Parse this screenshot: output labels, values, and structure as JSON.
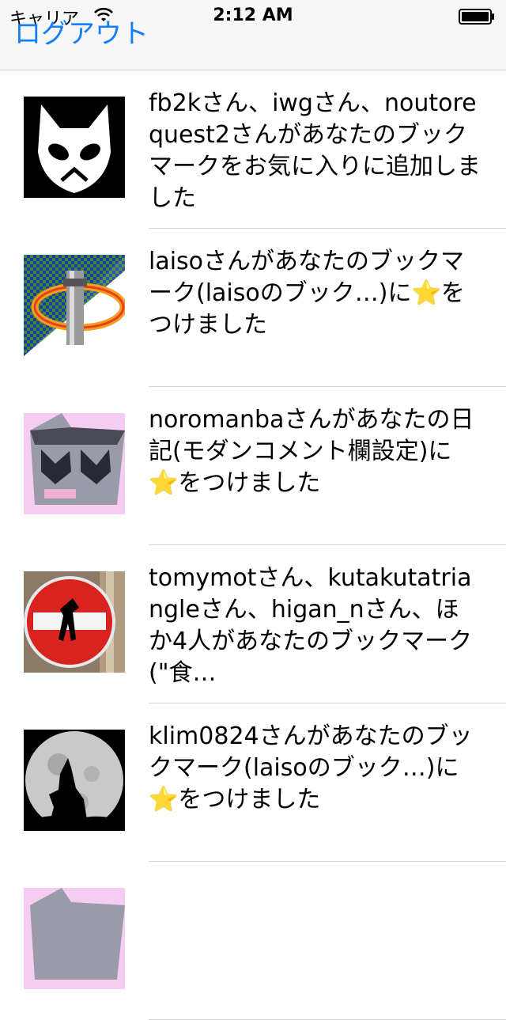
{
  "status_bar": {
    "carrier": "キャリア",
    "time": "2:12 AM"
  },
  "nav": {
    "logout_label": "ログアウト"
  },
  "notifications": [
    {
      "avatar_icon": "alien-mask-avatar-icon",
      "text_before": "fb2kさん、iwgさん、noutorequest2さんがあなたのブックマークをお気に入りに追加しました",
      "star": "",
      "text_after": ""
    },
    {
      "avatar_icon": "pixel-ring-avatar-icon",
      "text_before": "laisoさんがあなたのブックマーク(laisoのブック…)に",
      "star": "⭐",
      "text_after": "をつけました"
    },
    {
      "avatar_icon": "pixel-cat-avatar-icon",
      "text_before": "noromanbaさんがあなたの日記(モダンコメント欄設定)に",
      "star": "⭐",
      "text_after": "をつけました"
    },
    {
      "avatar_icon": "no-entry-sign-avatar-icon",
      "text_before": "tomymotさん、kutakutatriangleさん、higan_nさん、ほか4人があなたのブックマーク(\"食…",
      "star": "",
      "text_after": ""
    },
    {
      "avatar_icon": "wolf-moon-avatar-icon",
      "text_before": "klim0824さんがあなたのブックマーク(laisoのブック…)に",
      "star": "⭐",
      "text_after": "をつけました"
    },
    {
      "avatar_icon": "pixel-cat-avatar-icon",
      "text_before": "",
      "star": "",
      "text_after": ""
    }
  ],
  "colors": {
    "accent": "#147efb",
    "star": "#f5c400",
    "navbar_bg": "#f7f7f7"
  }
}
